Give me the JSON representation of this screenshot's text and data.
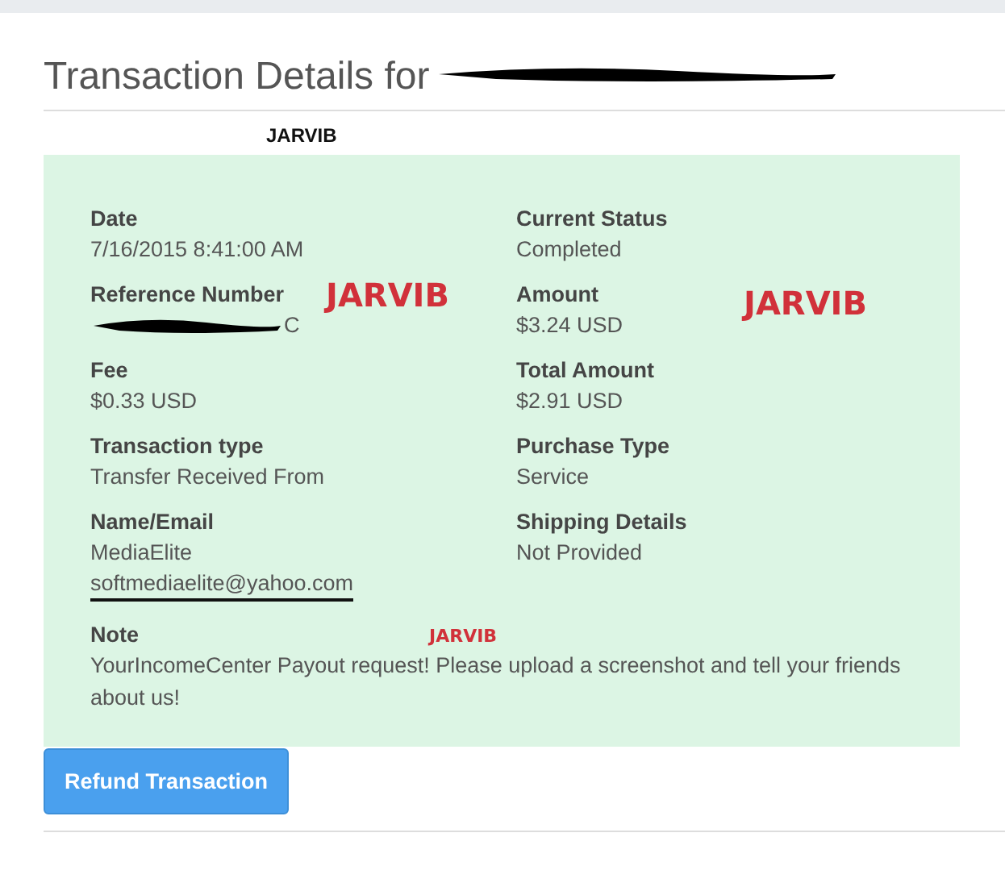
{
  "title": {
    "text": "Transaction Details for",
    "redacted": true
  },
  "marks": [
    {
      "text": "JARVIB",
      "kind": "plain"
    },
    {
      "text": "JARVIB",
      "kind": "red-large"
    },
    {
      "text": "JARVIB",
      "kind": "red-large"
    },
    {
      "text": "JARVIB",
      "kind": "red-small"
    }
  ],
  "fields": [
    {
      "label": "Date",
      "values": [
        "7/16/2015 8:41:00 AM"
      ]
    },
    {
      "label": "Current Status",
      "values": [
        "Completed"
      ]
    },
    {
      "label": "Reference Number",
      "values": [
        "C"
      ],
      "redacted": true
    },
    {
      "label": "Amount",
      "values": [
        "$3.24 USD"
      ]
    },
    {
      "label": "Fee",
      "values": [
        "$0.33 USD"
      ]
    },
    {
      "label": "Total Amount",
      "values": [
        "$2.91 USD"
      ]
    },
    {
      "label": "Transaction type",
      "values": [
        "Transfer Received From"
      ]
    },
    {
      "label": "Purchase Type",
      "values": [
        "Service"
      ]
    },
    {
      "label": "Name/Email",
      "values": [
        "MediaElite",
        "softmediaelite@yahoo.com"
      ],
      "underlined": true
    },
    {
      "label": "Shipping Details",
      "values": [
        "Not Provided"
      ]
    }
  ],
  "note": {
    "label": "Note",
    "text": "YourIncomeCenter Payout request! Please upload a screenshot and tell your friends about us!"
  },
  "button": "Refund Transaction"
}
